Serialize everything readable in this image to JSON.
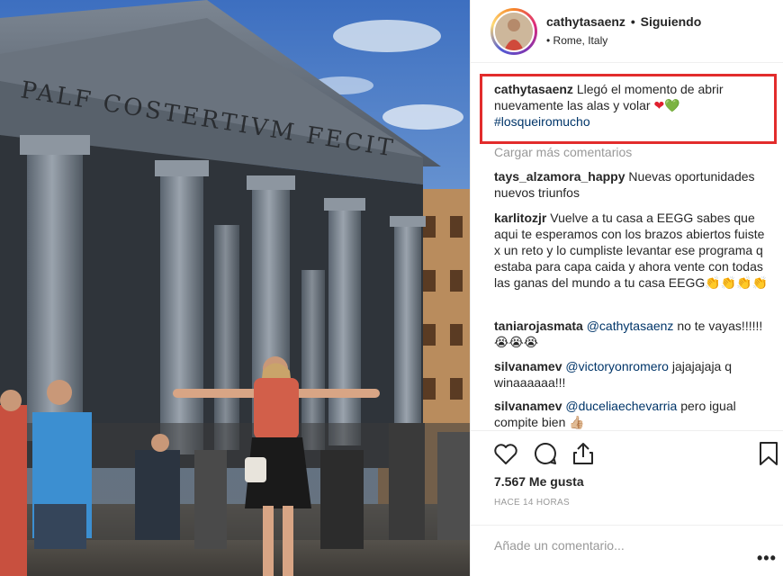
{
  "post": {
    "username": "cathytasaenz",
    "dot": "•",
    "follow_status": "Siguiendo",
    "location": "Rome, Italy",
    "photo_inscription": "PALF COSTERTIVM FECIT"
  },
  "caption": {
    "username": "cathytasaenz",
    "text": "Llegó el momento de abrir nuevamente las alas y volar",
    "heart_red": "❤",
    "heart_green": "💚",
    "hashtag": "#losqueiromucho"
  },
  "load_more_label": "Cargar más comentarios",
  "comments": [
    {
      "username": "tays_alzamora_happy",
      "text": "Nuevas oportunidades nuevos triunfos"
    },
    {
      "username": "karlitozjr",
      "text": "Vuelve a tu casa a EEGG sabes que aqui te esperamos con los brazos abiertos fuiste x un reto y lo cumpliste levantar ese programa q estaba para capa caida y ahora vente con todas las ganas del mundo a tu casa EEGG👏👏👏👏"
    },
    {
      "username": "taniarojasmata",
      "mention": "@cathytasaenz",
      "text": "no te vayas!!!!!! 😭😭😭"
    },
    {
      "username": "silvanamev",
      "mention": "@victoryonromero",
      "text": "jajajajaja q winaaaaaa!!!"
    },
    {
      "username": "silvanamev",
      "mention": "@duceliaechevarria",
      "text": "pero igual compite bien 👍🏼"
    }
  ],
  "likes_label": "7.567 Me gusta",
  "time_label": "HACE 14 HORAS",
  "add_comment_placeholder": "Añade un comentario...",
  "more_label": "•••",
  "colors": {
    "highlight_border": "#e22c2c",
    "link": "#003569",
    "muted": "#999999"
  }
}
